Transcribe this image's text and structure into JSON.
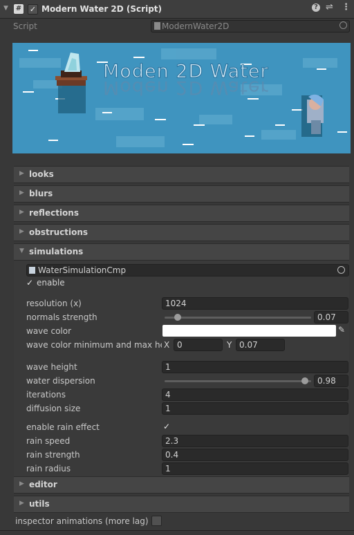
{
  "header": {
    "title": "Modern Water 2D (Script)",
    "enabled": true
  },
  "script_field": {
    "label": "Script",
    "value": "ModernWater2D"
  },
  "banner": {
    "title": "Moden 2D Water"
  },
  "sections": {
    "looks": "looks",
    "blurs": "blurs",
    "reflections": "reflections",
    "obstructions": "obstructions",
    "simulations": "simulations",
    "editor": "editor",
    "utils": "utils"
  },
  "simulation": {
    "component": "WaterSimulationCmp",
    "enable_label": "enable",
    "enable": true,
    "resolution_label": "resolution (x)",
    "resolution": "1024",
    "normals_strength_label": "normals strength",
    "normals_strength": "0.07",
    "normals_strength_fraction": 0.07,
    "wave_color_label": "wave color",
    "wave_color": "#ffffff",
    "wave_color_minmax_label": "wave color minimum and max height",
    "x_label": "X",
    "x_value": "0",
    "y_label": "Y",
    "y_value": "0.07",
    "wave_height_label": "wave height",
    "wave_height": "1",
    "water_dispersion_label": "water dispersion",
    "water_dispersion": "0.98",
    "water_dispersion_fraction": 0.98,
    "iterations_label": "iterations",
    "iterations": "4",
    "diffusion_size_label": "diffusion size",
    "diffusion_size": "1",
    "enable_rain_label": "enable rain effect",
    "enable_rain": true,
    "rain_speed_label": "rain speed",
    "rain_speed": "2.3",
    "rain_strength_label": "rain strength",
    "rain_strength": "0.4",
    "rain_radius_label": "rain radius",
    "rain_radius": "1"
  },
  "footer": {
    "inspector_animations_label": "inspector animations (more lag)",
    "inspector_animations": false
  },
  "colors": {
    "background": "#383838",
    "banner_water": "#3f94bf",
    "accent_text": "#d2d2d2"
  }
}
